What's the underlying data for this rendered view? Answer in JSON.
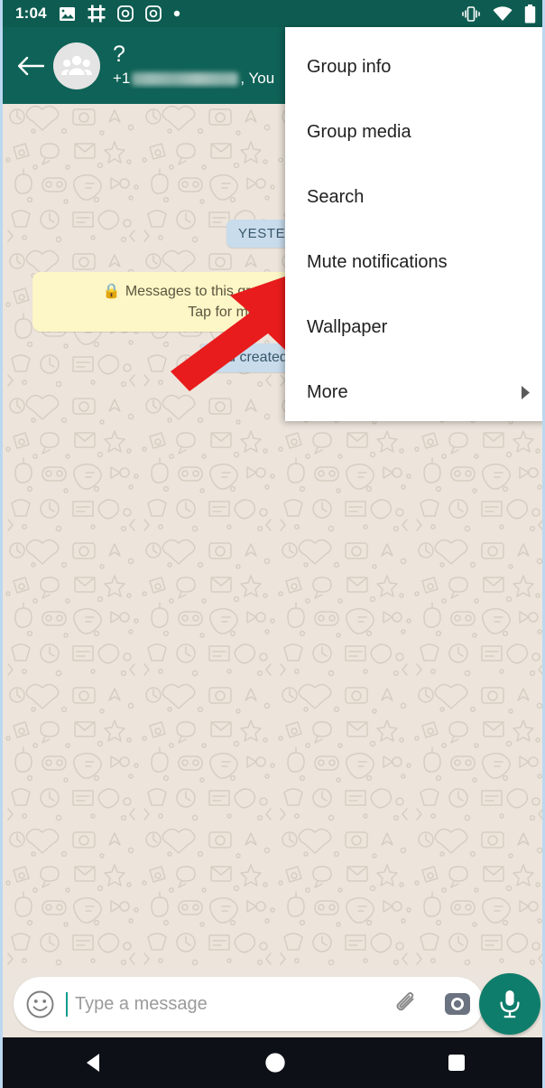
{
  "statusbar": {
    "time": "1:04",
    "left_icons": [
      "photo-icon",
      "slack-icon",
      "instagram-icon",
      "instagram-icon",
      "dot-icon"
    ],
    "right_icons": [
      "vibrate-icon",
      "wifi-icon",
      "battery-icon"
    ],
    "background_color": "#0e5c51"
  },
  "header": {
    "back_label": "back-arrow",
    "avatar_label": "group-avatar",
    "title": "?",
    "subtitle_prefix": "+1",
    "subtitle_suffix": ", You",
    "background_color": "#0f6257"
  },
  "chat": {
    "date_chip": "YESTERDAY",
    "encryption_notice_line1": "Messages to this group are now s",
    "encryption_notice_line2": "Tap for mo",
    "system_message": "You created",
    "wallpaper_color": "#ede5dc",
    "chip_color": "#c8dcec",
    "notice_color": "#fdf6c6"
  },
  "menu": {
    "items": [
      {
        "label": "Group info",
        "has_submenu": false
      },
      {
        "label": "Group media",
        "has_submenu": false
      },
      {
        "label": "Search",
        "has_submenu": false
      },
      {
        "label": "Mute notifications",
        "has_submenu": false
      },
      {
        "label": "Wallpaper",
        "has_submenu": false
      },
      {
        "label": "More",
        "has_submenu": true
      }
    ],
    "background_color": "#ffffff"
  },
  "annotation": {
    "arrow_color": "#e81c1c",
    "points_to": "Mute notifications"
  },
  "input": {
    "placeholder": "Type a message",
    "emoji_icon": "smiley-icon",
    "attach_icon": "paperclip-icon",
    "camera_icon": "camera-icon",
    "mic_icon": "microphone-icon",
    "mic_color": "#0f7d6b"
  },
  "navbar": {
    "back": "triangle-back-icon",
    "home": "circle-home-icon",
    "recents": "square-recents-icon",
    "background_color": "#0d1117"
  }
}
